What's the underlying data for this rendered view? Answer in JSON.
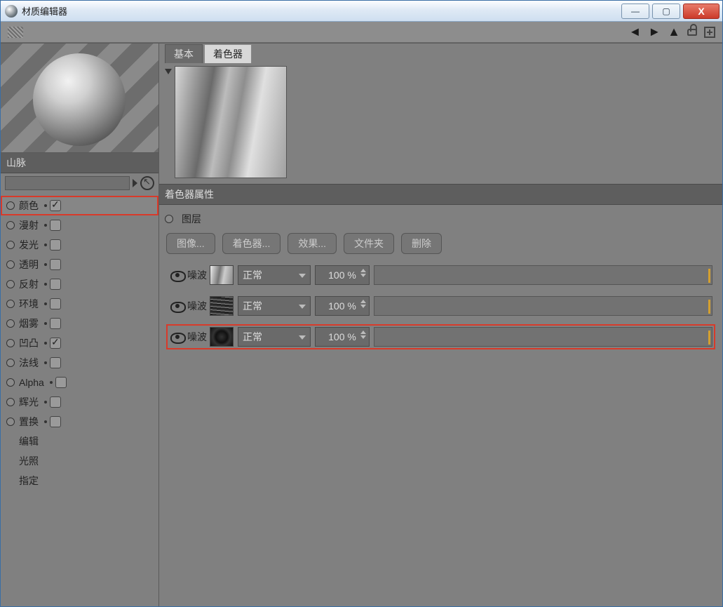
{
  "window": {
    "title": "材质编辑器"
  },
  "material": {
    "name": "山脉"
  },
  "channels": [
    {
      "key": "color",
      "label": "颜色",
      "hasCheck": true,
      "checked": true,
      "highlight": true
    },
    {
      "key": "diffuse",
      "label": "漫射",
      "hasCheck": true,
      "checked": false,
      "highlight": false
    },
    {
      "key": "lumin",
      "label": "发光",
      "hasCheck": true,
      "checked": false,
      "highlight": false
    },
    {
      "key": "transp",
      "label": "透明",
      "hasCheck": true,
      "checked": false,
      "highlight": false
    },
    {
      "key": "reflect",
      "label": "反射",
      "hasCheck": true,
      "checked": false,
      "highlight": false
    },
    {
      "key": "env",
      "label": "环境",
      "hasCheck": true,
      "checked": false,
      "highlight": false
    },
    {
      "key": "fog",
      "label": "烟雾",
      "hasCheck": true,
      "checked": false,
      "highlight": false
    },
    {
      "key": "bump",
      "label": "凹凸",
      "hasCheck": true,
      "checked": true,
      "highlight": false
    },
    {
      "key": "normal",
      "label": "法线",
      "hasCheck": true,
      "checked": false,
      "highlight": false
    },
    {
      "key": "alpha",
      "label": "Alpha",
      "hasCheck": true,
      "checked": false,
      "highlight": false
    },
    {
      "key": "glow",
      "label": "辉光",
      "hasCheck": true,
      "checked": false,
      "highlight": false
    },
    {
      "key": "displ",
      "label": "置换",
      "hasCheck": true,
      "checked": false,
      "highlight": false
    },
    {
      "key": "edit",
      "label": "编辑",
      "hasCheck": false,
      "checked": false,
      "highlight": false
    },
    {
      "key": "illum",
      "label": "光照",
      "hasCheck": false,
      "checked": false,
      "highlight": false
    },
    {
      "key": "assign",
      "label": "指定",
      "hasCheck": false,
      "checked": false,
      "highlight": false
    }
  ],
  "tabs": {
    "basic": "基本",
    "shader": "着色器"
  },
  "section": {
    "shader_props": "着色器属性",
    "layers_label": "图层"
  },
  "buttons": {
    "image": "图像...",
    "shader": "着色器...",
    "effect": "效果...",
    "folder": "文件夹",
    "delete": "删除"
  },
  "layers": [
    {
      "name": "噪波",
      "blend": "正常",
      "opacity": "100 %",
      "thumb": "t1",
      "highlight": false
    },
    {
      "name": "噪波",
      "blend": "正常",
      "opacity": "100 %",
      "thumb": "t2",
      "highlight": false
    },
    {
      "name": "噪波",
      "blend": "正常",
      "opacity": "100 %",
      "thumb": "t3",
      "highlight": true
    }
  ]
}
